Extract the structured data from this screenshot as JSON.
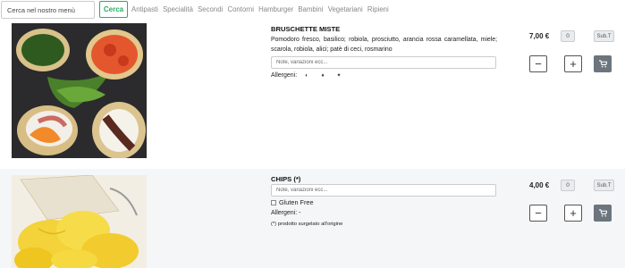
{
  "search": {
    "placeholder": "Cerca nel nostro menù",
    "button": "Cerca"
  },
  "categories": [
    "Antipasti",
    "Specialità",
    "Secondi",
    "Contorni",
    "Hamburger",
    "Bambini",
    "Vegetariani",
    "Ripieni"
  ],
  "items": [
    {
      "title": "BRUSCHETTE MISTE",
      "description": "Pomodoro fresco, basilico; robiola, prosciutto, arancia rossa caramellata, miele; scarola, robiola, alici; patè di ceci, rosmarino",
      "notes_placeholder": "Note, variazioni ecc...",
      "allergens_label": "Allergeni:",
      "allergen_icons": [
        "milk-icon",
        "fish-icon",
        "gluten-icon"
      ],
      "price": "7,00 €",
      "qty": "0",
      "subtotal_label": "Sub.T",
      "minus": "−",
      "plus": "+"
    },
    {
      "title": "CHIPS (*)",
      "notes_placeholder": "Note, variazioni ecc...",
      "gluten_free_label": "Gluten Free",
      "allergens_label": "Allergeni: -",
      "frozen_note": "(*) prodotto surgelato all'origine",
      "price": "4,00 €",
      "qty": "0",
      "subtotal_label": "Sub.T",
      "minus": "−",
      "plus": "+"
    }
  ],
  "colors": {
    "accent": "#27ae60",
    "cart_button": "#6c757d",
    "row_alt_bg": "#f4f6f8"
  }
}
